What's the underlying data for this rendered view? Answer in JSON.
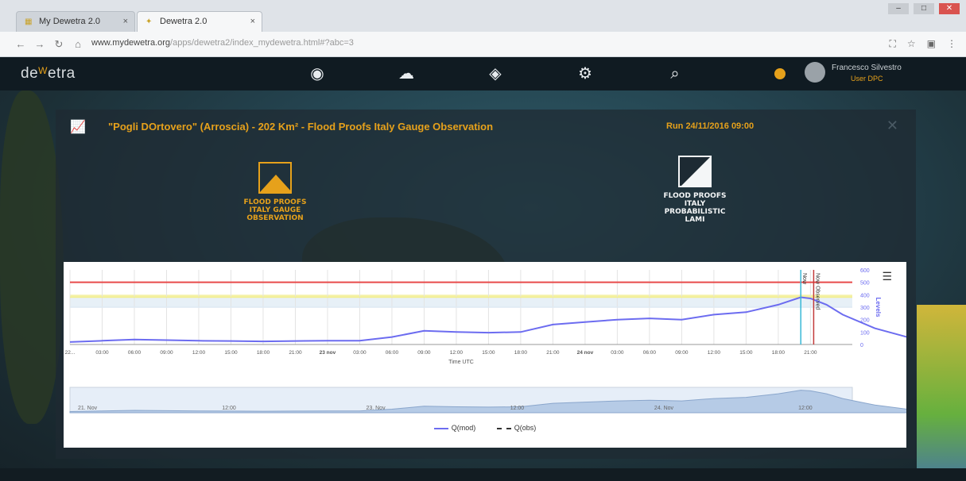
{
  "browser": {
    "tabs": [
      {
        "label": "My Dewetra 2.0",
        "close": "×"
      },
      {
        "label": "Dewetra 2.0",
        "close": "×"
      }
    ],
    "url_host": "www.mydewetra.org",
    "url_path": "/apps/dewetra2/index_mydewetra.html#?abc=3"
  },
  "app": {
    "logo_text": "de",
    "logo_sup": "W",
    "logo_rest": "etra",
    "user_name": "Francesco Silvestro",
    "user_role": "User DPC"
  },
  "panel": {
    "title": "\"Pogli DOrtovero\" (Arroscia) - 202 Km² - Flood Proofs Italy Gauge Observation",
    "run": "Run 24/11/2016 09:00",
    "close": "✕",
    "products": [
      {
        "label": "FLOOD PROOFS ITALY GAUGE OBSERVATION"
      },
      {
        "label": "FLOOD PROOFS ITALY PROBABILISTIC LAMI"
      }
    ]
  },
  "chart_data": {
    "type": "line",
    "xlabel": "Time UTC",
    "ylabel": "Levels",
    "ylim": [
      0,
      600
    ],
    "y_ticks": [
      0,
      100,
      200,
      300,
      400,
      500,
      600
    ],
    "x_ticks": [
      "22...",
      "03:00",
      "06:00",
      "09:00",
      "12:00",
      "15:00",
      "18:00",
      "21:00",
      "23 nov",
      "03:00",
      "06:00",
      "09:00",
      "12:00",
      "15:00",
      "18:00",
      "21:00",
      "24 nov",
      "03:00",
      "06:00",
      "09:00",
      "12:00",
      "15:00",
      "18:00",
      "21:00"
    ],
    "x_tick_bold": [
      false,
      false,
      false,
      false,
      false,
      false,
      false,
      false,
      true,
      false,
      false,
      false,
      false,
      false,
      false,
      false,
      true,
      false,
      false,
      false,
      false,
      false,
      false,
      false
    ],
    "thresholds": [
      {
        "value": 500,
        "color": "#e84a4a"
      },
      {
        "value": 380,
        "color": "#f2ee90"
      },
      {
        "value": 300,
        "color": "#dde9f4"
      }
    ],
    "markers": [
      {
        "x": 22.7,
        "color": "#38b8d6",
        "label": "Now"
      },
      {
        "x": 23.1,
        "color": "#c23a3a",
        "label": "Now Observed"
      }
    ],
    "series": [
      {
        "name": "Q(mod)",
        "color": "#6c6cf0",
        "x": [
          0,
          1,
          2,
          3,
          4,
          5,
          6,
          7,
          8,
          9,
          10,
          11,
          12,
          13,
          14,
          15,
          16,
          17,
          18,
          19,
          20,
          21,
          22,
          22.7,
          23,
          23.5,
          24,
          25,
          26,
          27,
          28,
          29
        ],
        "y": [
          20,
          30,
          40,
          35,
          30,
          28,
          25,
          28,
          30,
          30,
          60,
          110,
          100,
          95,
          100,
          160,
          180,
          200,
          210,
          200,
          240,
          260,
          320,
          380,
          370,
          320,
          240,
          130,
          60,
          35,
          25,
          20
        ]
      }
    ],
    "navigator_ticks": [
      "21. Nov",
      "12:00",
      "23. Nov",
      "12:00",
      "24. Nov",
      "12:00"
    ],
    "legend": [
      {
        "label": "Q(mod)",
        "style": "solid"
      },
      {
        "label": "Q(obs)",
        "style": "dashed"
      }
    ]
  }
}
